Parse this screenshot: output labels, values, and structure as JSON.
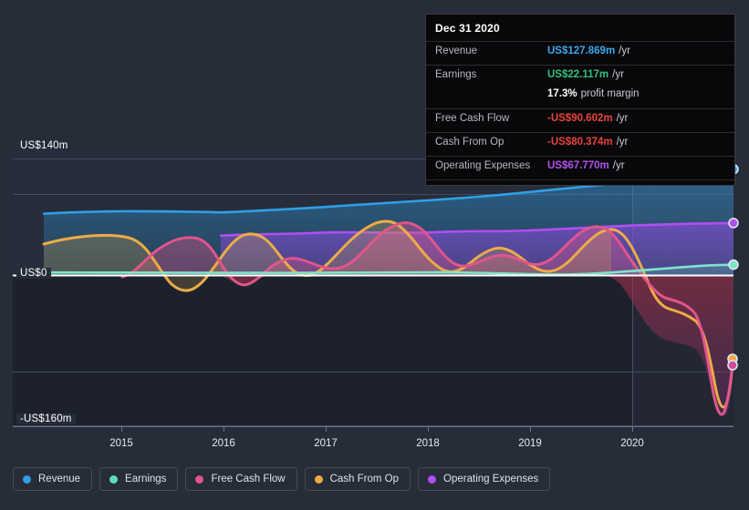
{
  "tooltip": {
    "title": "Dec 31 2020",
    "rows": [
      {
        "label": "Revenue",
        "value": "US$127.869m",
        "suffix": "/yr",
        "color": "#3ba9f0"
      },
      {
        "label": "Earnings",
        "value": "US$22.117m",
        "suffix": "/yr",
        "color": "#2ec27e"
      },
      {
        "label": "",
        "value": "17.3%",
        "suffix": "profit margin",
        "color": "#ffffff",
        "sub": true
      },
      {
        "label": "Free Cash Flow",
        "value": "-US$90.602m",
        "suffix": "/yr",
        "color": "#e8453c"
      },
      {
        "label": "Cash From Op",
        "value": "-US$80.374m",
        "suffix": "/yr",
        "color": "#e8453c"
      },
      {
        "label": "Operating Expenses",
        "value": "US$67.770m",
        "suffix": "/yr",
        "color": "#b452f0"
      }
    ]
  },
  "legend": {
    "items": [
      {
        "label": "Revenue",
        "color": "#2f9fe8"
      },
      {
        "label": "Earnings",
        "color": "#5fdcc0"
      },
      {
        "label": "Free Cash Flow",
        "color": "#e0558c"
      },
      {
        "label": "Cash From Op",
        "color": "#edab47"
      },
      {
        "label": "Operating Expenses",
        "color": "#b14ef0"
      }
    ]
  },
  "chart_data": {
    "type": "area",
    "title": "",
    "xlabel": "",
    "ylabel": "",
    "ylim": [
      -160,
      140
    ],
    "y_ticks": [
      "US$140m",
      "US$0",
      "-US$160m"
    ],
    "y_tick_values": [
      140,
      0,
      -160
    ],
    "x_ticks": [
      "2015",
      "2016",
      "2017",
      "2018",
      "2019",
      "2020"
    ],
    "grid": true,
    "legend_position": "bottom",
    "units": "US$ millions per year",
    "series": [
      {
        "name": "Revenue",
        "color": "#2f9fe8",
        "x": [
          2014.35,
          2014.7,
          2015.0,
          2015.5,
          2016.0,
          2016.5,
          2017.0,
          2017.5,
          2018.0,
          2018.5,
          2019.0,
          2019.5,
          2020.0,
          2020.25,
          2020.5,
          2020.75,
          2021.0
        ],
        "values": [
          71,
          73,
          74,
          74,
          73,
          75,
          77,
          79,
          81,
          83,
          86,
          90,
          96,
          102,
          110,
          119,
          127.869
        ],
        "end_value": 127.869
      },
      {
        "name": "Earnings",
        "color": "#5fdcc0",
        "x": [
          2014.35,
          2015.0,
          2015.5,
          2016.0,
          2016.5,
          2017.0,
          2017.5,
          2018.0,
          2018.5,
          2019.0,
          2019.5,
          2020.0,
          2020.5,
          2021.0
        ],
        "values": [
          2.5,
          2.5,
          2.0,
          2.0,
          2.5,
          3.0,
          3.5,
          3.0,
          2.5,
          4.0,
          7.0,
          8.0,
          14.0,
          22.117
        ],
        "end_value": 22.117
      },
      {
        "name": "Free Cash Flow",
        "color": "#e0558c",
        "x": [
          2015.9,
          2016.1,
          2016.3,
          2016.5,
          2016.75,
          2017.0,
          2017.25,
          2017.6,
          2017.9,
          2018.2,
          2018.5,
          2018.8,
          2019.1,
          2019.4,
          2019.7,
          2020.0,
          2020.3,
          2020.6,
          2020.85,
          2021.0
        ],
        "values": [
          -3,
          30,
          36,
          8,
          -10,
          12,
          20,
          6,
          40,
          44,
          16,
          18,
          8,
          34,
          40,
          -5,
          -38,
          -62,
          -155,
          -90.602
        ],
        "end_value": -90.602
      },
      {
        "name": "Cash From Op",
        "color": "#edab47",
        "x": [
          2014.35,
          2014.7,
          2015.0,
          2015.3,
          2015.6,
          2015.9,
          2016.1,
          2016.3,
          2016.5,
          2016.75,
          2017.0,
          2017.25,
          2017.6,
          2017.9,
          2018.2,
          2018.5,
          2018.8,
          2019.1,
          2019.4,
          2019.7,
          2020.0,
          2020.3,
          2020.6,
          2020.85,
          2021.0
        ],
        "values": [
          30,
          37,
          38,
          34,
          12,
          -6,
          32,
          39,
          11,
          -8,
          15,
          23,
          10,
          44,
          48,
          20,
          22,
          12,
          38,
          44,
          2,
          -30,
          -54,
          -147,
          -80.374
        ],
        "end_value": -80.374
      },
      {
        "name": "Operating Expenses",
        "color": "#b14ef0",
        "x": [
          2015.95,
          2016.2,
          2016.6,
          2017.0,
          2017.4,
          2017.8,
          2018.2,
          2018.6,
          2019.0,
          2019.4,
          2019.8,
          2020.2,
          2020.6,
          2021.0
        ],
        "values": [
          49,
          50,
          50,
          51,
          50,
          52,
          51,
          52,
          53,
          55,
          56,
          59,
          63,
          67.77
        ],
        "end_value": 67.77
      }
    ],
    "highlight_band": {
      "from": "2020",
      "to": "end"
    }
  }
}
